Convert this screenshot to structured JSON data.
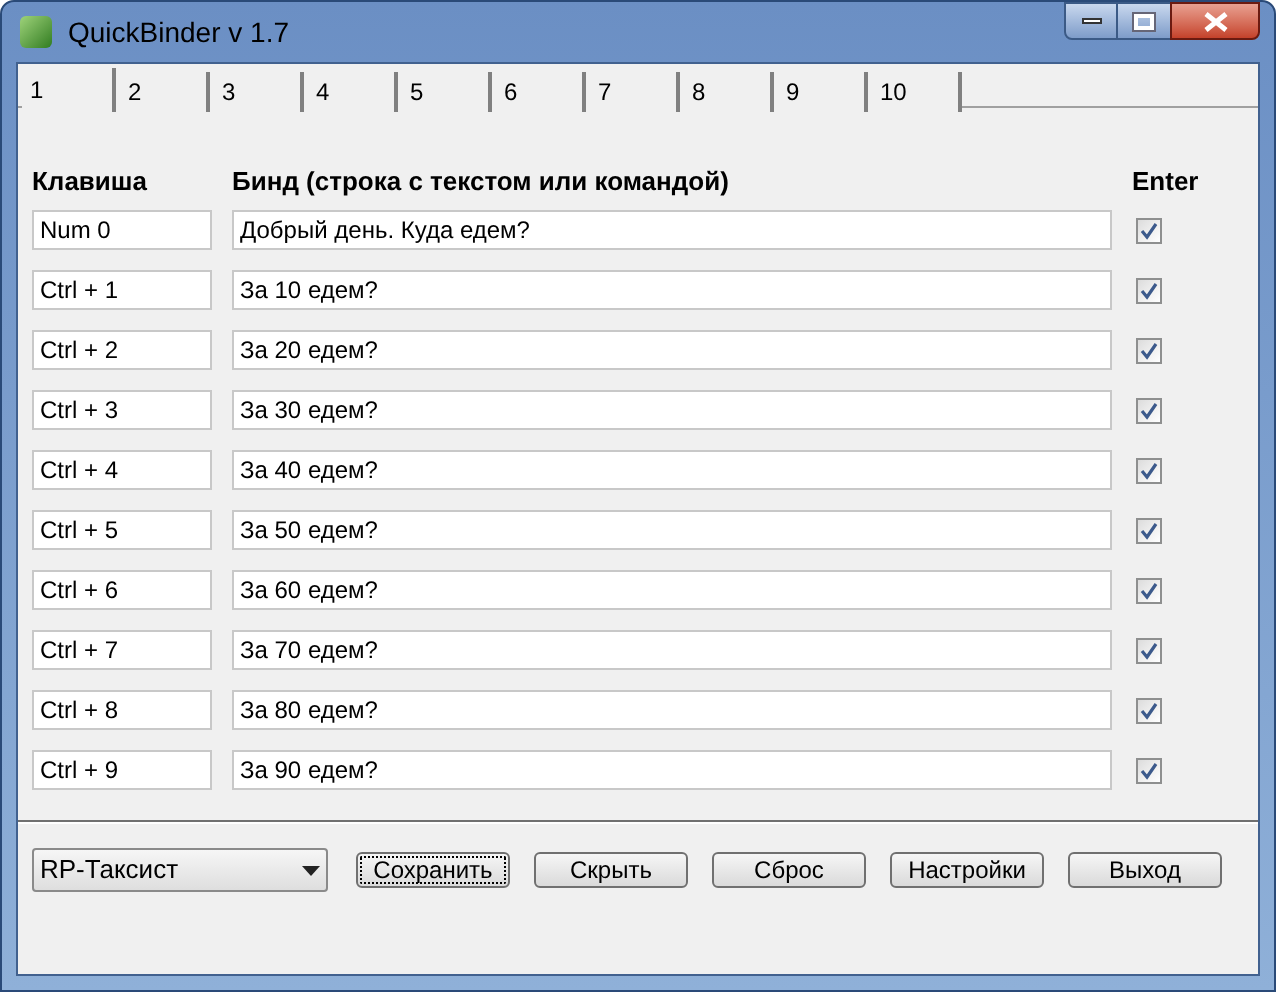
{
  "window": {
    "title": "QuickBinder v 1.7"
  },
  "tabs": [
    {
      "label": "1",
      "selected": true
    },
    {
      "label": "2",
      "selected": false
    },
    {
      "label": "3",
      "selected": false
    },
    {
      "label": "4",
      "selected": false
    },
    {
      "label": "5",
      "selected": false
    },
    {
      "label": "6",
      "selected": false
    },
    {
      "label": "7",
      "selected": false
    },
    {
      "label": "8",
      "selected": false
    },
    {
      "label": "9",
      "selected": false
    },
    {
      "label": "10",
      "selected": false
    }
  ],
  "table": {
    "columns": [
      "Клавиша",
      "Бинд (строка с текстом или командой)",
      "Enter"
    ],
    "rows": [
      {
        "key": "Num 0",
        "bind": "Добрый день. Куда едем?",
        "enter": true
      },
      {
        "key": "Ctrl + 1",
        "bind": "За 10 едем?",
        "enter": true
      },
      {
        "key": "Ctrl + 2",
        "bind": "За 20 едем?",
        "enter": true
      },
      {
        "key": "Ctrl + 3",
        "bind": "За 30 едем?",
        "enter": true
      },
      {
        "key": "Ctrl + 4",
        "bind": "За 40 едем?",
        "enter": true
      },
      {
        "key": "Ctrl + 5",
        "bind": "За 50 едем?",
        "enter": true
      },
      {
        "key": "Ctrl + 6",
        "bind": "За 60 едем?",
        "enter": true
      },
      {
        "key": "Ctrl + 7",
        "bind": "За 70 едем?",
        "enter": true
      },
      {
        "key": "Ctrl + 8",
        "bind": "За 80 едем?",
        "enter": true
      },
      {
        "key": "Ctrl + 9",
        "bind": "За 90 едем?",
        "enter": true
      }
    ]
  },
  "profile_select": {
    "value": "RP-Таксист"
  },
  "buttons": [
    {
      "label": "Сохранить",
      "focused": true
    },
    {
      "label": "Скрыть",
      "focused": false
    },
    {
      "label": "Сброс",
      "focused": false
    },
    {
      "label": "Настройки",
      "focused": false
    },
    {
      "label": "Выход",
      "focused": false
    }
  ]
}
